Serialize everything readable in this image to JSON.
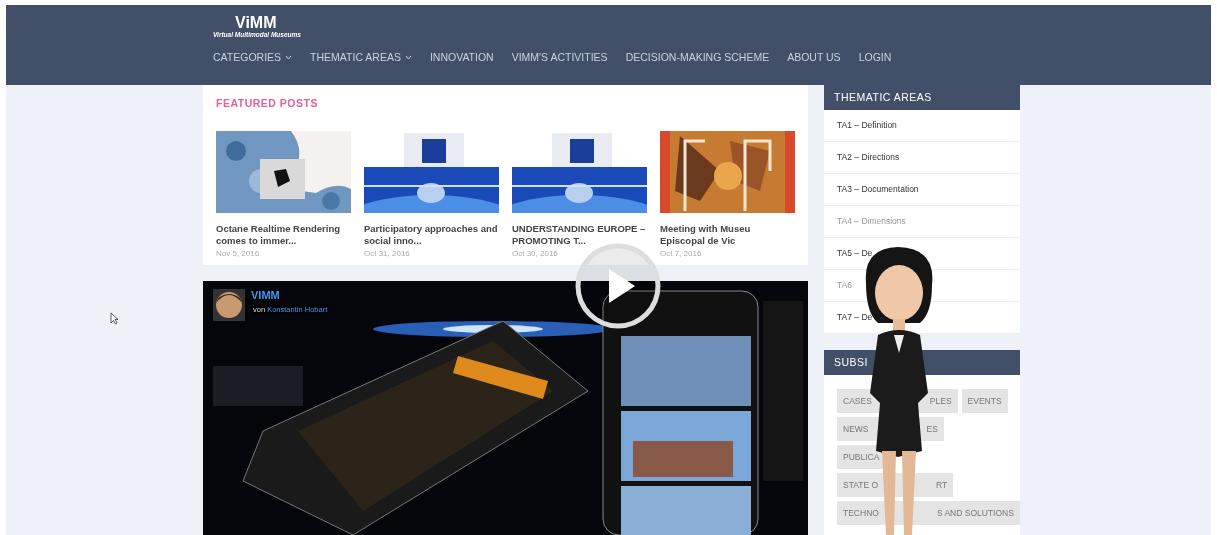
{
  "header": {
    "logo": "ViMM",
    "logo_subtitle": "Virtual Multimodal Museums",
    "nav": [
      {
        "label": "CATEGORIES",
        "dropdown": true
      },
      {
        "label": "THEMATIC AREAS",
        "dropdown": true
      },
      {
        "label": "INNOVATION",
        "dropdown": false
      },
      {
        "label": "VIMM'S ACTIVITIES",
        "dropdown": false
      },
      {
        "label": "DECISION-MAKING SCHEME",
        "dropdown": false
      },
      {
        "label": "ABOUT US",
        "dropdown": false
      },
      {
        "label": "LOGIN",
        "dropdown": false
      }
    ]
  },
  "featured_posts": {
    "title": "FEATURED POSTS",
    "posts": [
      {
        "title": "Octane Realtime Rendering comes to immer...",
        "date": "Nov 5, 2016"
      },
      {
        "title": "Participatory approaches and social inno...",
        "date": "Oct 31, 2016"
      },
      {
        "title": "UNDERSTANDING EUROPE – PROMOTING T...",
        "date": "Oct 30, 2016"
      },
      {
        "title": "Meeting with Museu Episcopal de Vic",
        "date": "Oct 7, 2016"
      }
    ]
  },
  "video": {
    "channel": "VIMM",
    "byline_prefix": "von",
    "author": "Konstantin Hobart"
  },
  "sidebar": {
    "thematic_areas": {
      "title": "THEMATIC AREAS",
      "items": [
        {
          "label": "TA1 – Definition",
          "dimmed": false
        },
        {
          "label": "TA2 – Directions",
          "dimmed": false
        },
        {
          "label": "TA3 – Documentation",
          "dimmed": false
        },
        {
          "label": "TA4 – Dimensions",
          "dimmed": true
        },
        {
          "label": "TA5 – De",
          "dimmed": false
        },
        {
          "label": "TA6",
          "dimmed": true
        },
        {
          "label": "TA7 – De",
          "dimmed": false
        }
      ]
    },
    "subsidiary": {
      "title": "SUBSI",
      "tag_rows": [
        [
          {
            "left": "CASES",
            "right": "PLES"
          },
          {
            "left": "EVENTS"
          }
        ],
        [
          {
            "left": "NEWS",
            "right": "ES"
          }
        ],
        [
          {
            "left": "PUBLICA"
          }
        ],
        [
          {
            "left": "STATE O",
            "right": "RT"
          }
        ],
        [
          {
            "left": "TECHNO",
            "right": "S AND SOLUTIONS"
          }
        ]
      ]
    }
  }
}
